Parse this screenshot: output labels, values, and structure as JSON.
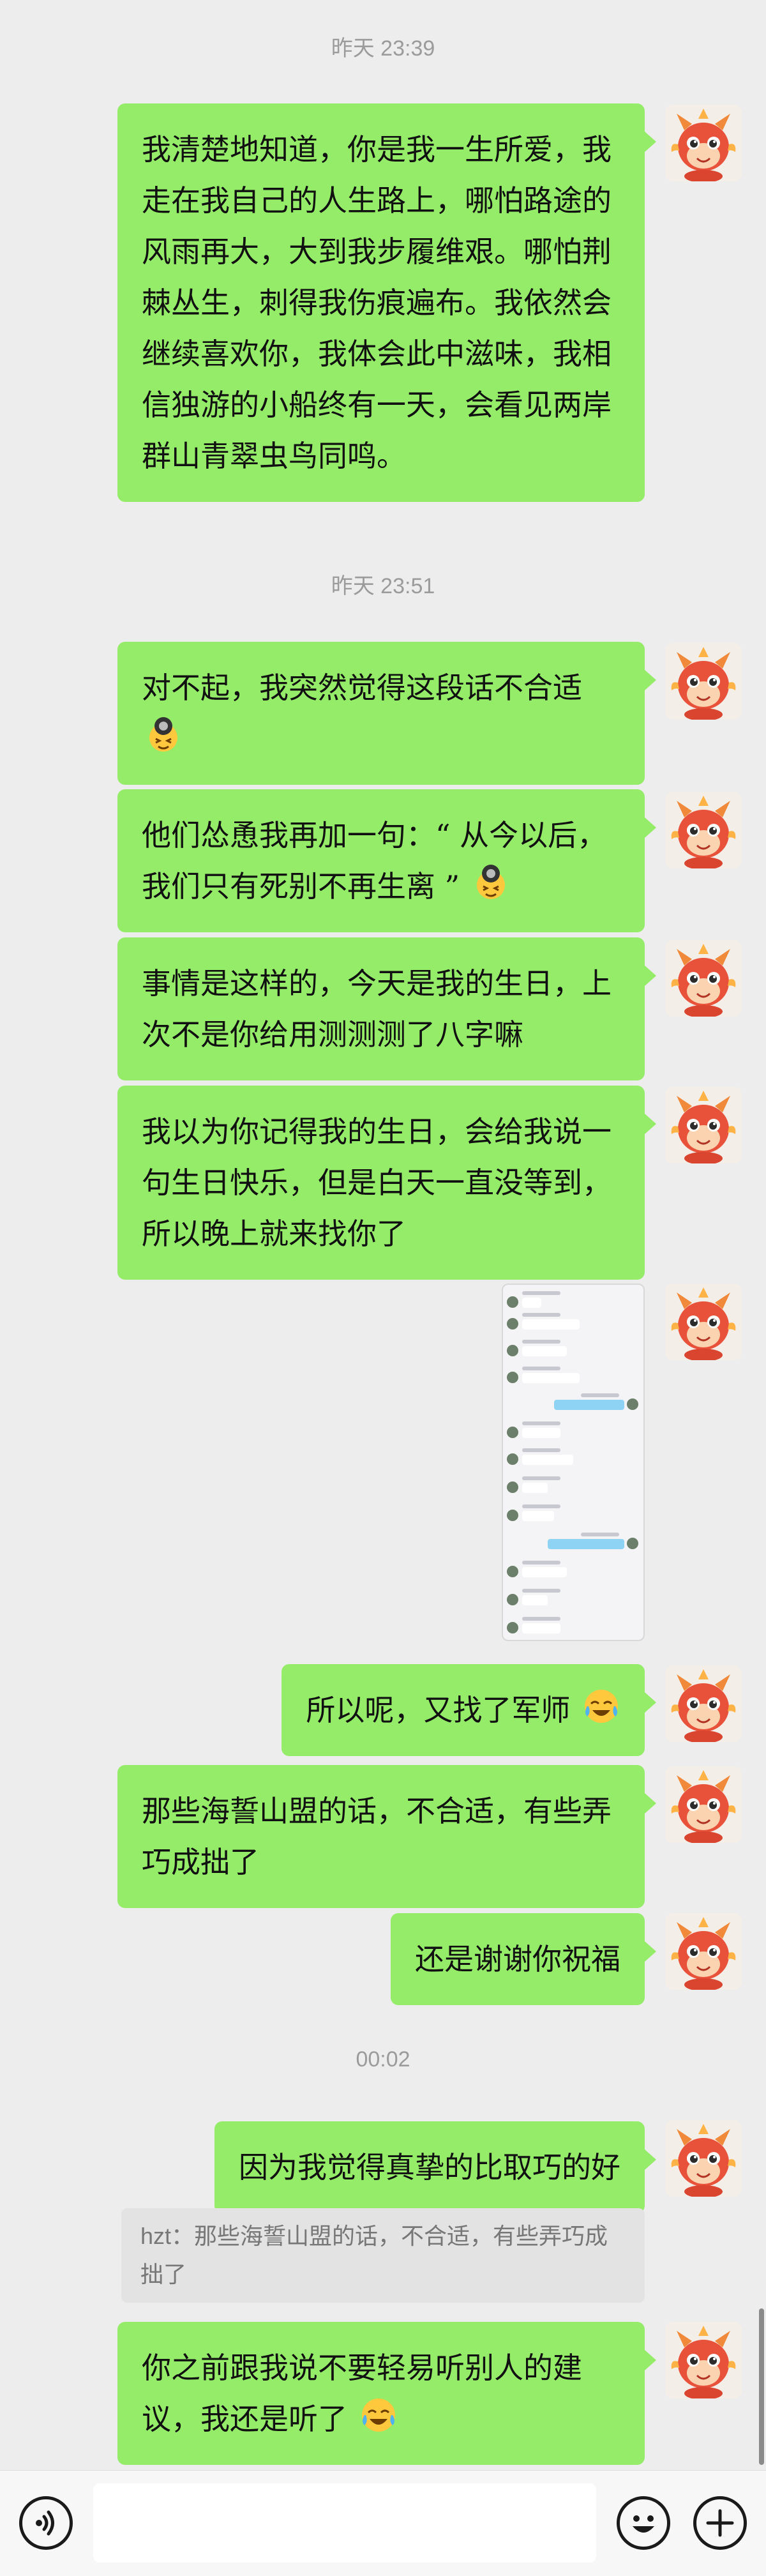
{
  "timestamps": [
    "昨天 23:39",
    "昨天 23:51",
    "00:02"
  ],
  "messages": [
    {
      "text": "我清楚地知道，你是我一生所爱，我走在我自己的人生路上，哪怕路途的风雨再大，大到我步履维艰。哪怕荆棘丛生，刺得我伤痕遍布。我依然会继续喜欢你，我体会此中滋味，我相信独游的小船终有一天，会看见两岸群山青翠虫鸟同鸣。"
    },
    {
      "text": "对不起，我突然觉得这段话不合适",
      "emoji": "facepalm-emoji"
    },
    {
      "text": "他们怂恿我再加一句：“ 从今以后，我们只有死别不再生离 ”",
      "emoji": "facepalm-emoji"
    },
    {
      "text": "事情是这样的，今天是我的生日，上次不是你给用测测测了八字嘛"
    },
    {
      "text": "我以为你记得我的生日，会给我说一句生日快乐，但是白天一直没等到，所以晚上就来找你了"
    },
    {
      "type": "image",
      "description_icon": "chat-screenshot-image"
    },
    {
      "text": "所以呢，又找了军师",
      "emoji": "crying-laughing-emoji"
    },
    {
      "text": "那些海誓山盟的话，不合适，有些弄巧成拙了"
    },
    {
      "text": "还是谢谢你祝福"
    },
    {
      "text": "因为我觉得真挚的比取巧的好"
    },
    {
      "text": "你之前跟我说不要轻易听别人的建议，我还是听了",
      "emoji": "crying-laughing-emoji"
    }
  ],
  "quote": {
    "text": "hzt：那些海誓山盟的话，不合适，有些弄巧成拙了"
  },
  "input_bar": {
    "voice_icon": "voice-icon",
    "emoji_icon": "smiley-icon",
    "plus_icon": "plus-icon"
  },
  "colors": {
    "bubble": "#95ec69",
    "background": "#ededed",
    "timestamp": "#9b9b9b"
  }
}
